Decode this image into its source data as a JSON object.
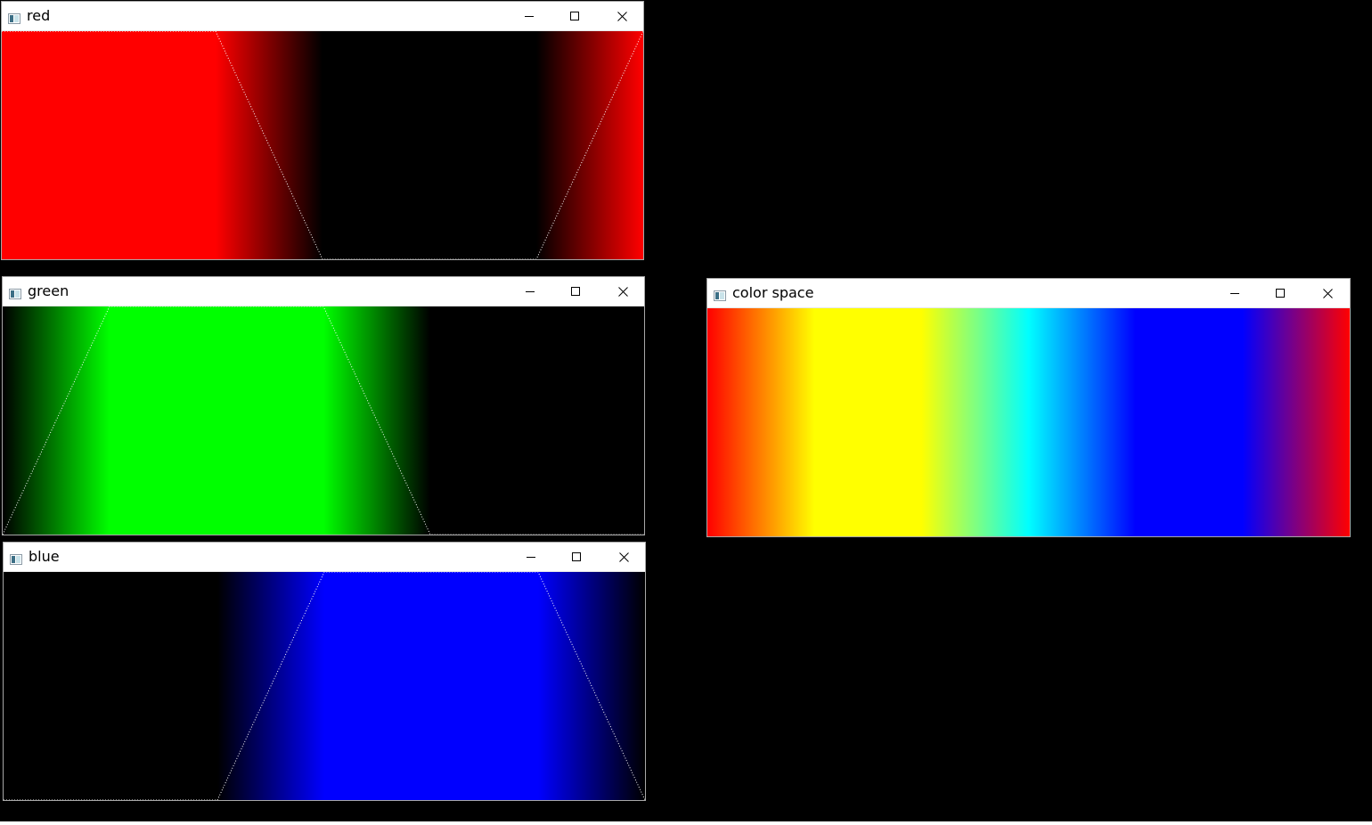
{
  "windows": {
    "red": {
      "title": "red",
      "color": "#ff0000",
      "curve": [
        [
          0,
          1
        ],
        [
          120,
          1
        ],
        [
          180,
          0
        ],
        [
          300,
          0
        ],
        [
          360,
          1
        ]
      ]
    },
    "green": {
      "title": "green",
      "color": "#00ff00",
      "curve": [
        [
          0,
          0
        ],
        [
          60,
          1
        ],
        [
          180,
          1
        ],
        [
          240,
          0
        ],
        [
          360,
          0
        ]
      ]
    },
    "blue": {
      "title": "blue",
      "color": "#0000ff",
      "curve": [
        [
          0,
          0
        ],
        [
          120,
          0
        ],
        [
          180,
          1
        ],
        [
          300,
          1
        ],
        [
          360,
          0
        ]
      ]
    },
    "colorspace": {
      "title": "color space"
    }
  },
  "controls": {
    "minimize_icon": "minimize-icon",
    "maximize_icon": "maximize-icon",
    "close_icon": "close-icon",
    "app_icon": "window-app-icon"
  }
}
